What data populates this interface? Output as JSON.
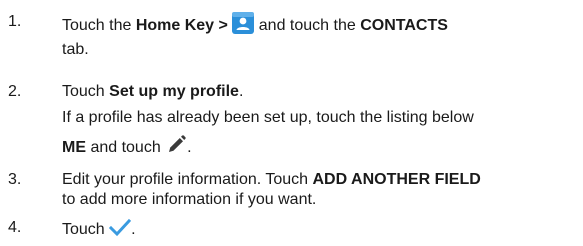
{
  "steps": [
    {
      "number": "1.",
      "line1_a": "Touch the ",
      "line1_b": "Home Key >",
      "line1_c": " and touch the ",
      "line1_d": "CONTACTS",
      "line2": "tab."
    },
    {
      "number": "2.",
      "line1_a": "Touch ",
      "line1_b": "Set up my profile",
      "line1_c": ".",
      "line2": "If a profile has already been set up, touch the listing below",
      "line3_a": "ME",
      "line3_b": " and touch ",
      "line3_c": "."
    },
    {
      "number": "3.",
      "line1_a": "Edit your profile information. Touch ",
      "line1_b": "ADD ANOTHER FIELD",
      "line2": "to add more information if you want."
    },
    {
      "number": "4.",
      "line1_a": "Touch ",
      "line1_b": "."
    }
  ],
  "icons": {
    "contacts": "contacts-app-icon",
    "edit": "pencil-icon",
    "save": "checkmark-icon"
  },
  "colors": {
    "contacts_icon_bg": "#2b8fd9",
    "checkmark": "#3a9be0",
    "pencil": "#3a3a3a"
  }
}
